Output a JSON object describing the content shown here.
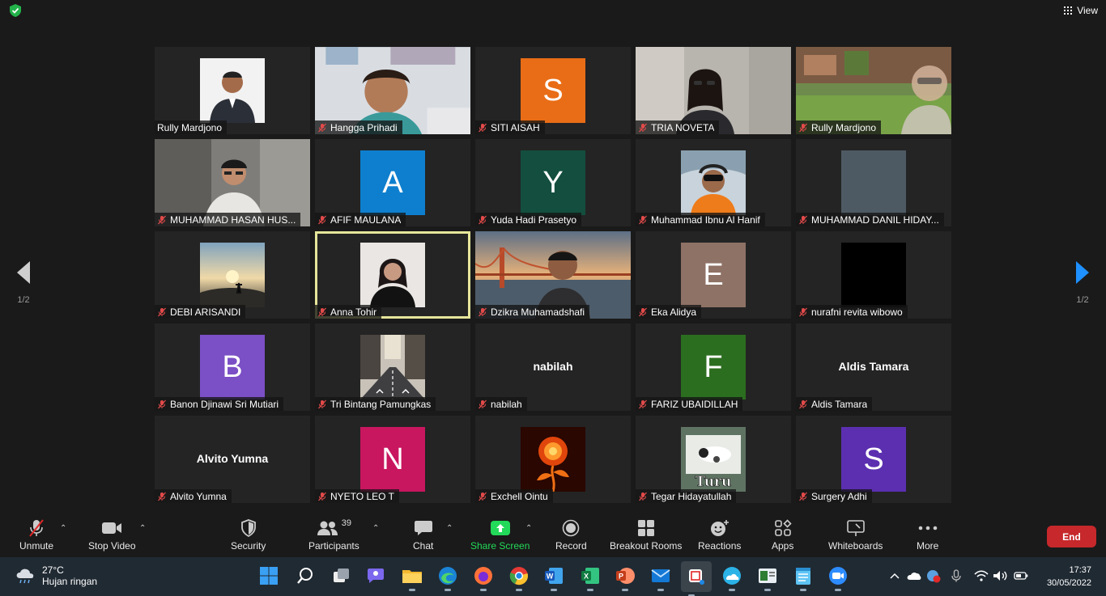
{
  "topbar": {
    "view_label": "View"
  },
  "nav": {
    "page_left": "1/2",
    "page_right": "1/2"
  },
  "tiles": [
    {
      "name": "Rully Mardjono",
      "kind": "photo",
      "mic_off": false,
      "speaking": true,
      "photo": "man-suit"
    },
    {
      "name": "Hangga Prihadi",
      "kind": "video",
      "mic_off": true,
      "photo": "woman-room"
    },
    {
      "name": "SITI AISAH",
      "kind": "avatar",
      "mic_off": true,
      "letter": "S",
      "color": "#e96d16"
    },
    {
      "name": "TRIA NOVETA",
      "kind": "video",
      "mic_off": true,
      "photo": "woman-blur"
    },
    {
      "name": "Rully Mardjono",
      "kind": "video",
      "mic_off": true,
      "photo": "garden"
    },
    {
      "name": "MUHAMMAD HASAN HUS...",
      "kind": "video",
      "mic_off": true,
      "photo": "man-blur"
    },
    {
      "name": "AFIF MAULANA",
      "kind": "avatar",
      "mic_off": true,
      "letter": "A",
      "color": "#0e7fce"
    },
    {
      "name": "Yuda Hadi Prasetyo",
      "kind": "avatar",
      "mic_off": true,
      "letter": "Y",
      "color": "#134e3e"
    },
    {
      "name": "Muhammad Ibnu Al Hanif",
      "kind": "photo",
      "mic_off": true,
      "photo": "pilot"
    },
    {
      "name": "MUHAMMAD DANIL HIDAY...",
      "kind": "photo",
      "mic_off": true,
      "photo": "grey"
    },
    {
      "name": "DEBI ARISANDI",
      "kind": "photo",
      "mic_off": true,
      "photo": "sunset"
    },
    {
      "name": "Anna Tohir",
      "kind": "photo",
      "mic_off": true,
      "active": true,
      "photo": "woman-dark"
    },
    {
      "name": "Dzikra Muhamadshafi",
      "kind": "video",
      "mic_off": true,
      "photo": "bridge"
    },
    {
      "name": "Eka Alidya",
      "kind": "avatar",
      "mic_off": true,
      "letter": "E",
      "color": "#8e7265"
    },
    {
      "name": "nurafni revita wibowo",
      "kind": "photo",
      "mic_off": true,
      "photo": "black"
    },
    {
      "name": "Banon Djinawi Sri Mutiari",
      "kind": "avatar",
      "mic_off": true,
      "letter": "B",
      "color": "#7b4fc5"
    },
    {
      "name": "Tri Bintang Pamungkas",
      "kind": "photo",
      "mic_off": true,
      "photo": "street"
    },
    {
      "name": "nabilah",
      "kind": "text",
      "mic_off": true,
      "display": "nabilah"
    },
    {
      "name": "FARIZ UBAIDILLAH",
      "kind": "avatar",
      "mic_off": true,
      "letter": "F",
      "color": "#2c6e1f"
    },
    {
      "name": "Aldis Tamara",
      "kind": "text",
      "mic_off": true,
      "display": "Aldis Tamara"
    },
    {
      "name": "Alvito Yumna",
      "kind": "text",
      "mic_off": true,
      "display": "Alvito Yumna"
    },
    {
      "name": "NYETO LEO T",
      "kind": "avatar",
      "mic_off": true,
      "letter": "N",
      "color": "#c8165f"
    },
    {
      "name": "Exchell Ointu",
      "kind": "photo",
      "mic_off": true,
      "photo": "fire-rose"
    },
    {
      "name": "Tegar Hidayatullah",
      "kind": "photo",
      "mic_off": true,
      "photo": "turu",
      "caption": "Turu"
    },
    {
      "name": "Surgery Adhi",
      "kind": "avatar",
      "mic_off": true,
      "letter": "S",
      "color": "#5b2fb0"
    }
  ],
  "controls": {
    "unmute": "Unmute",
    "stop_video": "Stop Video",
    "security": "Security",
    "participants": "Participants",
    "participants_count": "39",
    "chat": "Chat",
    "share_screen": "Share Screen",
    "record": "Record",
    "breakout_rooms": "Breakout Rooms",
    "reactions": "Reactions",
    "apps": "Apps",
    "whiteboards": "Whiteboards",
    "more": "More",
    "end": "End"
  },
  "taskbar": {
    "temperature": "27°C",
    "weather": "Hujan ringan",
    "time": "17:37",
    "date": "30/05/2022"
  }
}
